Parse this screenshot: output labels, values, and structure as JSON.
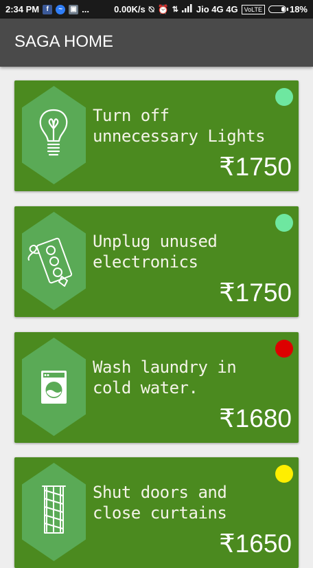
{
  "status_bar": {
    "time": "2:34 PM",
    "more": "...",
    "network_speed": "0.00K/s",
    "carrier": "Jio 4G 4G",
    "volte": "VoLTE",
    "battery": "18%"
  },
  "app_bar": {
    "title": "SAGA HOME"
  },
  "cards": [
    {
      "title": "Turn off unnecessary Lights",
      "price": "₹1750",
      "icon": "light-bulb-icon",
      "dot_color": "#6ee7a0"
    },
    {
      "title": "Unplug unused electronics",
      "price": "₹1750",
      "icon": "power-socket-icon",
      "dot_color": "#6ee7a0"
    },
    {
      "title": "Wash laundry in cold water.",
      "price": "₹1680",
      "icon": "washing-machine-icon",
      "dot_color": "#dd0000"
    },
    {
      "title": "Shut doors and close curtains",
      "price": "₹1650",
      "icon": "window-curtain-icon",
      "dot_color": "#ffee00"
    }
  ],
  "colors": {
    "card": "#4b8a1f",
    "hexagon": "#5aaa56",
    "app_bar": "#4a4a4a"
  }
}
